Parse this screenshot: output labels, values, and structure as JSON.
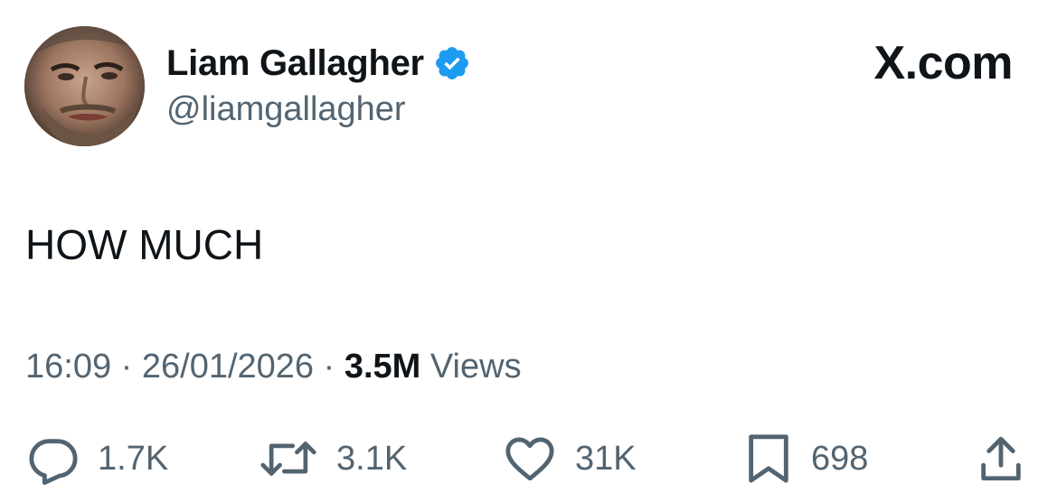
{
  "brand": {
    "label": "X.com"
  },
  "author": {
    "display_name": "Liam Gallagher",
    "handle": "@liamgallagher",
    "verified": true,
    "verified_color": "#1d9bf0",
    "avatar_icon": "profile-photo"
  },
  "tweet": {
    "text": "HOW MUCH"
  },
  "meta": {
    "time": "16:09",
    "separator": "·",
    "date": "26/01/2026",
    "views_count": "3.5M",
    "views_label": "Views"
  },
  "actions": {
    "reply": {
      "icon": "reply-icon",
      "count": "1.7K"
    },
    "retweet": {
      "icon": "retweet-icon",
      "count": "3.1K"
    },
    "like": {
      "icon": "heart-icon",
      "count": "31K"
    },
    "bookmark": {
      "icon": "bookmark-icon",
      "count": "698"
    },
    "share": {
      "icon": "share-icon"
    }
  },
  "colors": {
    "text_primary": "#0f1419",
    "text_secondary": "#536471",
    "verified_badge": "#1d9bf0",
    "background": "#ffffff"
  }
}
